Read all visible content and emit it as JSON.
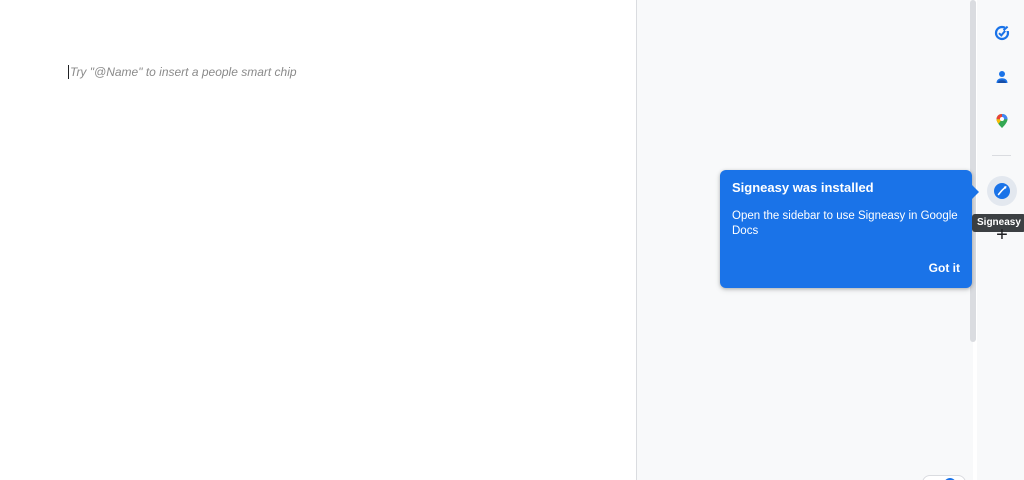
{
  "document": {
    "placeholder": "Try \"@Name\" to insert a people smart chip"
  },
  "side_panel": {
    "items": [
      {
        "name": "Tasks",
        "icon": "tasks-icon",
        "color": "#1a73e8"
      },
      {
        "name": "Contacts",
        "icon": "contacts-icon",
        "color": "#1a73e8"
      },
      {
        "name": "Maps",
        "icon": "maps-icon",
        "color": "#ea4335"
      },
      {
        "name": "Signeasy",
        "icon": "signeasy-icon",
        "color": "#1a73e8"
      },
      {
        "name": "Get add-ons",
        "icon": "plus-icon",
        "color": "#202124"
      }
    ],
    "tooltip": "Signeasy"
  },
  "popup": {
    "title": "Signeasy was installed",
    "body": "Open the sidebar to use Signeasy in Google Docs",
    "button_label": "Got it",
    "background": "#1a73e8"
  }
}
